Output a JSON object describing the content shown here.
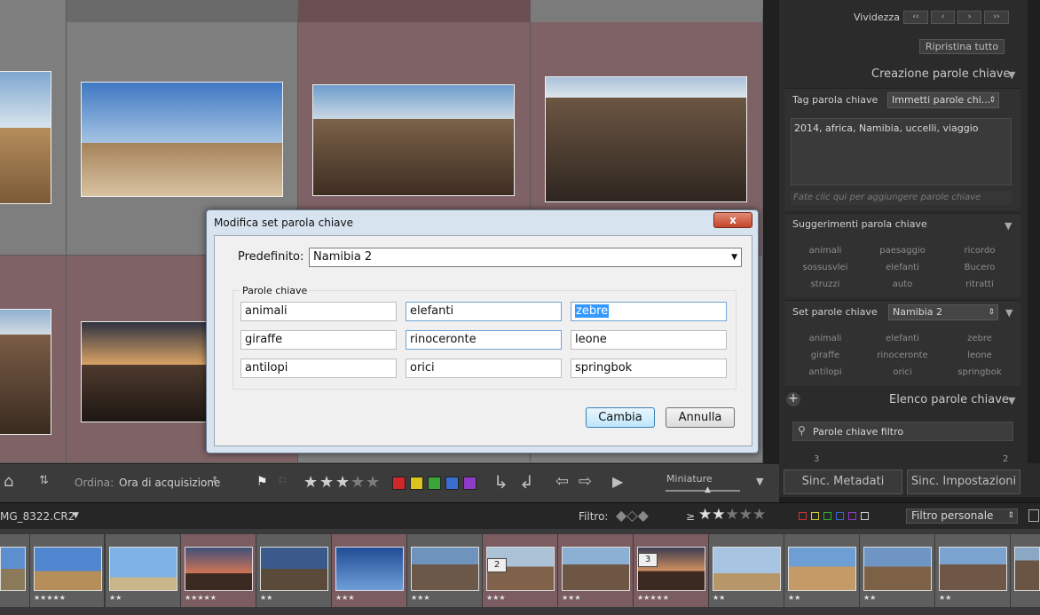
{
  "right_panel": {
    "vividness_label": "Vividezza",
    "vividness_buttons": [
      "‹‹",
      "‹",
      "›",
      "››"
    ],
    "reset_all": "Ripristina tutto",
    "keywording_title": "Creazione parole chiave",
    "tag_label": "Tag parola chiave",
    "tag_dropdown": "Immetti parole chi...",
    "tag_text": "2014, africa, Namibia, uccelli, viaggio",
    "tag_placeholder": "Fate clic qui per aggiungere parole chiave",
    "suggestions_title": "Suggerimenti parola chiave",
    "suggestions": [
      "animali",
      "paesaggio",
      "ricordo",
      "sossusvlei",
      "elefanti",
      "Bucero",
      "struzzi",
      "auto",
      "ritratti"
    ],
    "keyword_set_label": "Set parole chiave",
    "keyword_set_value": "Namibia 2",
    "keyword_set": [
      "animali",
      "elefanti",
      "zebre",
      "giraffe",
      "rinoceronte",
      "leone",
      "antilopi",
      "orici",
      "springbok"
    ],
    "keyword_list_title": "Elenco parole chiave",
    "filter_keywords": "Parole chiave filtro",
    "list_left": "3",
    "list_right": "2",
    "sync_metadata": "Sinc. Metadati",
    "sync_settings": "Sinc. Impostazioni"
  },
  "toolbar": {
    "sort_label": "Ordina:",
    "sort_value": "Ora di acquisizione",
    "thumbnails_label": "Miniature",
    "colors": [
      "#d0282a",
      "#d9c51c",
      "#3aa63a",
      "#3a6fd0",
      "#8e3cc7"
    ]
  },
  "filmstrip_header": {
    "filename": "MG_8322.CR2",
    "filter_label": "Filtro:",
    "gte_symbol": "≥",
    "filter_preset": "Filtro personale"
  },
  "filmstrip": {
    "items": [
      {
        "stars": ""
      },
      {
        "stars": "★★★★★"
      },
      {
        "stars": "★★"
      },
      {
        "stars": "★★★★★"
      },
      {
        "stars": "★★"
      },
      {
        "stars": "★★★"
      },
      {
        "stars": "★★★"
      },
      {
        "stars": "★★★",
        "badge": "2"
      },
      {
        "stars": "★★★"
      },
      {
        "stars": "★★★★★",
        "badge": "3"
      },
      {
        "stars": "★★"
      },
      {
        "stars": "★★"
      },
      {
        "stars": "★★"
      },
      {
        "stars": "★★"
      },
      {
        "stars": ""
      }
    ]
  },
  "dialog": {
    "title": "Modifica set parola chiave",
    "close": "x",
    "preset_label": "Predefinito:",
    "preset_value": "Namibia 2",
    "keywords_group": "Parole chiave",
    "keywords": [
      "animali",
      "elefanti",
      "zebre",
      "giraffe",
      "rinoceronte",
      "leone",
      "antilopi",
      "orici",
      "springbok"
    ],
    "change_button": "Cambia",
    "cancel_button": "Annulla"
  }
}
